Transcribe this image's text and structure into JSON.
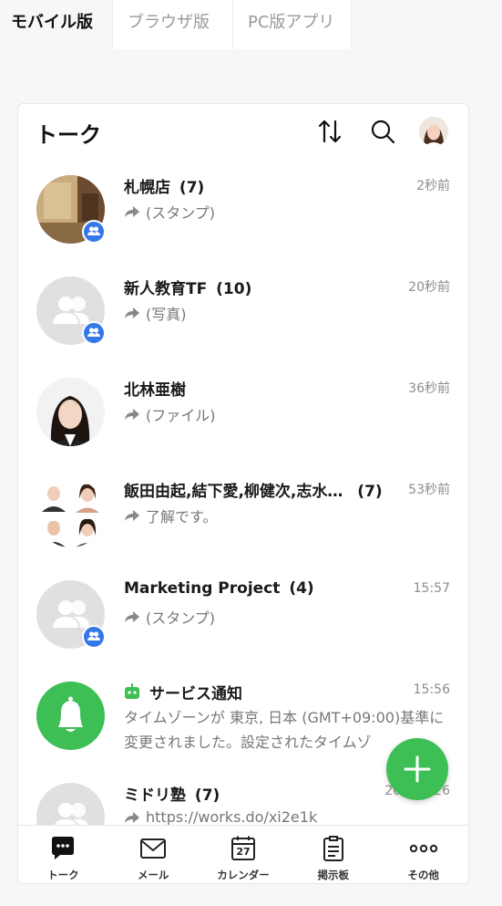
{
  "top_tabs": [
    {
      "label": "モバイル版",
      "active": true
    },
    {
      "label": "ブラウザ版",
      "active": false
    },
    {
      "label": "PC版アプリ",
      "active": false
    }
  ],
  "header": {
    "title": "トーク",
    "icons": [
      "sort-icon",
      "search-icon",
      "profile-avatar"
    ]
  },
  "chats": [
    {
      "name": "札幌店",
      "count": "(7)",
      "time": "2秒前",
      "message": "(スタンプ)",
      "avatar": "photo-room",
      "group": true
    },
    {
      "name": "新人教育TF",
      "count": "(10)",
      "time": "20秒前",
      "message": "(写真)",
      "avatar": "default-group",
      "group": true
    },
    {
      "name": "北林亜樹",
      "count": "",
      "time": "36秒前",
      "message": "(ファイル)",
      "avatar": "photo-woman",
      "group": false
    },
    {
      "name": "飯田由起,結下愛,柳健次,志水…",
      "count": "(7)",
      "time": "53秒前",
      "message": "了解です。",
      "avatar": "photo-collage",
      "group": false
    },
    {
      "name": "Marketing Project",
      "count": "(4)",
      "time": "15:57",
      "message": "(スタンプ)",
      "avatar": "default-group",
      "group": true
    },
    {
      "name": "サービス通知",
      "count": "",
      "time": "15:56",
      "message": "タイムゾーンが 東京, 日本 (GMT+09:00)基準に変更されました。設定されたタイムゾ",
      "avatar": "bell",
      "group": false
    },
    {
      "name": "ミドリ塾",
      "count": "(7)",
      "time": "2021/3/26",
      "message": "https://works.do/xi2e1k",
      "avatar": "default-group",
      "group": false
    }
  ],
  "bottom_nav": [
    {
      "label": "トーク",
      "icon": "chat-icon",
      "active": true
    },
    {
      "label": "メール",
      "icon": "mail-icon",
      "active": false
    },
    {
      "label": "カレンダー",
      "icon": "calendar-icon",
      "day": "27",
      "active": false
    },
    {
      "label": "掲示板",
      "icon": "board-icon",
      "active": false
    },
    {
      "label": "その他",
      "icon": "more-icon",
      "active": false
    }
  ],
  "colors": {
    "accent_green": "#3dbf56",
    "badge_blue": "#3477e8"
  }
}
